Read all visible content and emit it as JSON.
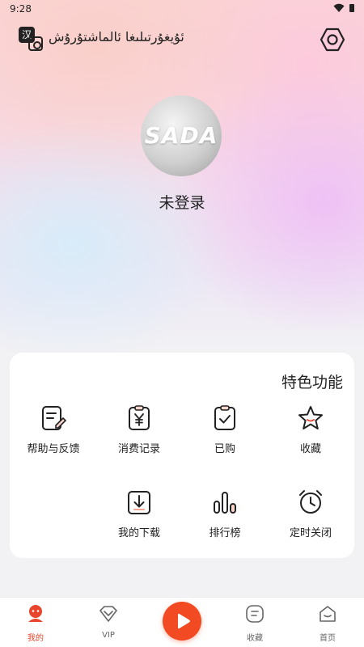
{
  "status_bar": {
    "time": "9:28"
  },
  "header": {
    "lang_switch_label": "汉",
    "app_title": "ئۇيغۇرتىلىغا ئالماشتۇرۇش"
  },
  "profile": {
    "avatar_text": "SADA",
    "login_status": "未登录"
  },
  "features": {
    "title": "特色功能",
    "items": [
      {
        "label": "帮助与反馈",
        "icon": "feedback-edit-icon"
      },
      {
        "label": "消费记录",
        "icon": "yen-receipt-icon"
      },
      {
        "label": "已购",
        "icon": "purchased-check-icon"
      },
      {
        "label": "收藏",
        "icon": "star-icon"
      },
      {
        "label": "我的下载",
        "icon": "download-icon"
      },
      {
        "label": "排行榜",
        "icon": "bar-chart-icon"
      },
      {
        "label": "定时关闭",
        "icon": "alarm-clock-icon"
      }
    ]
  },
  "bottom_nav": {
    "items": [
      {
        "label": "我的",
        "icon": "profile-icon",
        "active": true
      },
      {
        "label": "VIP",
        "icon": "vip-diamond-icon",
        "active": false
      },
      {
        "label": "收藏",
        "icon": "favorites-icon",
        "active": false
      },
      {
        "label": "首页",
        "icon": "home-icon",
        "active": false
      }
    ],
    "play_icon": "play-icon"
  },
  "colors": {
    "accent": "#f24a22",
    "active_nav": "#e8452c"
  }
}
